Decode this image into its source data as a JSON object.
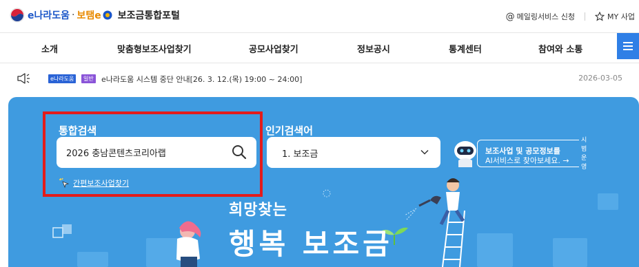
{
  "header": {
    "logo_enara": "e나라도움",
    "logo_dot": "·",
    "logo_botem": "보탬e",
    "site_title": "보조금통합포털",
    "mailing_label": "메일링서비스 신청",
    "my_business_label": "MY 사업"
  },
  "nav": {
    "items": [
      "소개",
      "맞춤형보조사업찾기",
      "공모사업찾기",
      "정보공시",
      "통계센터",
      "참여와 소통"
    ]
  },
  "notice": {
    "badge_site": "e나라도움",
    "badge_type": "일반",
    "text": "e나라도움 시스템 중단 안내[26. 3. 12.(목) 19:00 ~ 24:00]",
    "date": "2026-03-05"
  },
  "search": {
    "label": "통합검색",
    "value": "2026 충남콘텐츠코리아랩",
    "quick_link": "간편보조사업찾기"
  },
  "popular": {
    "label": "인기검색어",
    "selected": "1. 보조금"
  },
  "ai_banner": {
    "badge": "시범운영",
    "line1": "보조사업 및 공모정보를",
    "line2": "AI서비스로 찾아보세요. →"
  },
  "hero": {
    "slogan_line1": "희망찾는",
    "slogan_line2": "행복 보조금"
  },
  "colors": {
    "hero_bg": "#3f9be0",
    "brand_blue": "#1b56c8",
    "highlight": "#e31b1b",
    "menu_button": "#2f7fe6"
  }
}
